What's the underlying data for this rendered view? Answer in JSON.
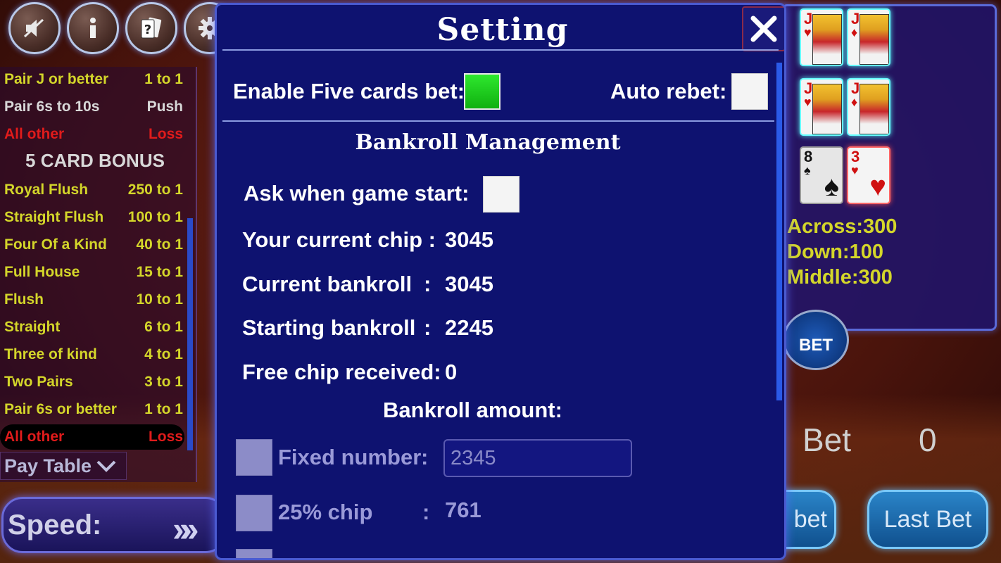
{
  "top_buttons": [
    {
      "name": "mute-button",
      "icon": "speaker-muted-icon"
    },
    {
      "name": "info-button",
      "icon": "info-icon"
    },
    {
      "name": "help-button",
      "icon": "help-cards-icon"
    },
    {
      "name": "settings-button",
      "icon": "gear-icon"
    }
  ],
  "paytable": {
    "rows_top": [
      {
        "hand": "Pair J or better",
        "payout": "1 to 1",
        "color": "yellow"
      },
      {
        "hand": "Pair 6s to 10s",
        "payout": "Push",
        "color": "grey"
      },
      {
        "hand": "All other",
        "payout": "Loss",
        "color": "red"
      }
    ],
    "bonus_header": "5 CARD BONUS",
    "rows_bonus": [
      {
        "hand": "Royal Flush",
        "payout": "250 to 1"
      },
      {
        "hand": "Straight Flush",
        "payout": "100 to 1"
      },
      {
        "hand": "Four Of a Kind",
        "payout": "40 to 1"
      },
      {
        "hand": "Full House",
        "payout": "15 to 1"
      },
      {
        "hand": "Flush",
        "payout": "10 to 1"
      },
      {
        "hand": "Straight",
        "payout": "6 to 1"
      },
      {
        "hand": "Three of kind",
        "payout": "4 to 1"
      },
      {
        "hand": "Two Pairs",
        "payout": "3 to 1"
      },
      {
        "hand": "Pair 6s or better",
        "payout": "1 to 1"
      }
    ],
    "row_last": {
      "hand": "All other",
      "payout": "Loss"
    },
    "toggle_label": "Pay Table"
  },
  "speed": {
    "label": "Speed:",
    "arrows": "»»"
  },
  "right_panel": {
    "cards": [
      {
        "rank": "J",
        "suit": "♥",
        "color": "#d01010"
      },
      {
        "rank": "J",
        "suit": "♦",
        "color": "#d01010"
      },
      {
        "rank": "J",
        "suit": "♥",
        "color": "#d01010"
      },
      {
        "rank": "J",
        "suit": "♦",
        "color": "#d01010"
      },
      {
        "rank": "8",
        "suit": "♠",
        "color": "#111111"
      },
      {
        "rank": "3",
        "suit": "♥",
        "color": "#d01010"
      }
    ],
    "across": "Across:300",
    "down": "Down:100",
    "middle": "Middle:300",
    "middle_bet_chip": "BET"
  },
  "bet": {
    "label": "Bet",
    "value": "0"
  },
  "buttons": {
    "rebet_partial": "bet",
    "last_bet": "Last Bet"
  },
  "settings": {
    "title": "Setting",
    "enable_five_cards_label": "Enable Five cards bet:",
    "enable_five_cards_checked": true,
    "auto_rebet_label": "Auto rebet:",
    "auto_rebet_checked": false,
    "bankroll_title": "Bankroll Management",
    "ask_when_start_label": "Ask when game start:",
    "ask_when_start_checked": false,
    "current_chip_label": "Your current chip :",
    "current_chip_value": "3045",
    "current_bankroll_label": "Current bankroll",
    "current_bankroll_value": "3045",
    "starting_bankroll_label": "Starting bankroll",
    "starting_bankroll_value": "2245",
    "free_chip_label": "Free chip received:",
    "free_chip_value": "0",
    "bankroll_amount_title": "Bankroll amount:",
    "fixed_number_label": "Fixed number",
    "fixed_number_value": "2345",
    "pct25_label": "25% chip",
    "pct25_value": "761",
    "colon": ":"
  }
}
